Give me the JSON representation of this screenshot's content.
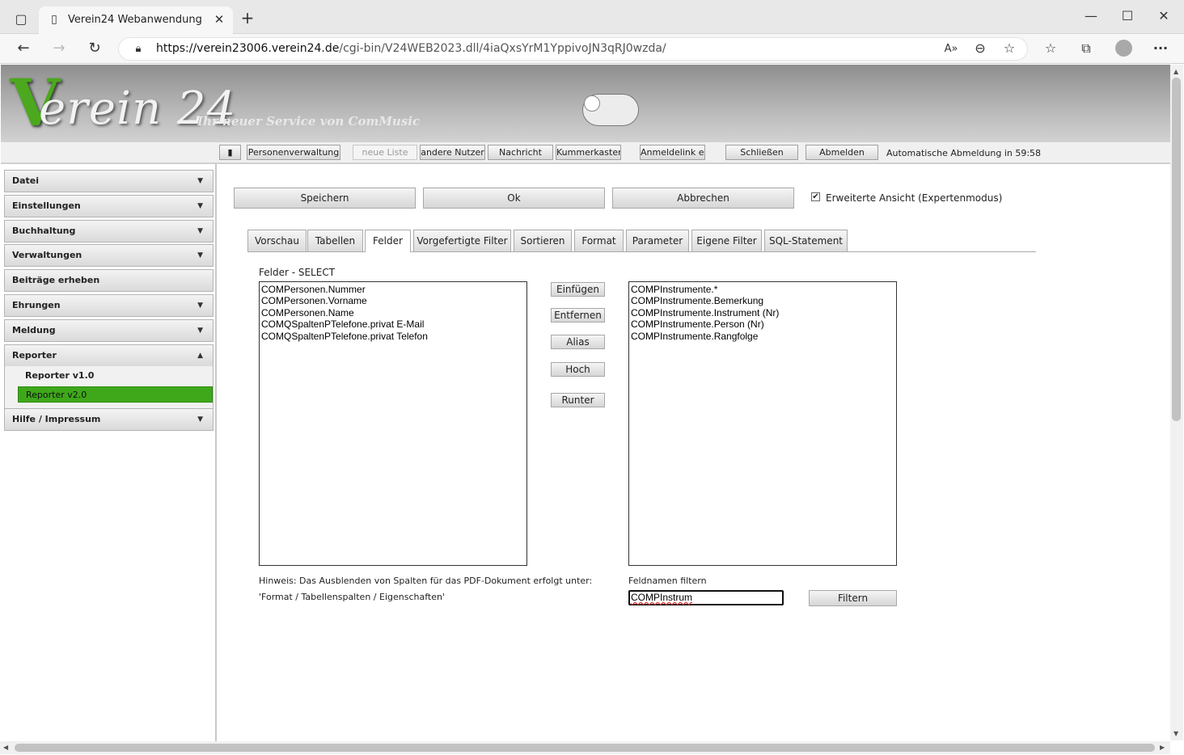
{
  "browser": {
    "tab_title": "Verein24 Webanwendung",
    "url_host": "https://verein23006.verein24.de",
    "url_path": "/cgi-bin/V24WEB2023.dll/4iaQxsYrM1YppivoJN3qRJ0wzda/"
  },
  "header": {
    "logo_v": "V",
    "logo_text": "erein 24",
    "slogan": "Ihr neuer Service von ComMusic"
  },
  "toolbar": {
    "menu_toggle": "▮",
    "buttons": [
      "Personenverwaltung",
      "neue Liste",
      "andere Nutzer",
      "Nachricht",
      "Kummerkasten",
      "Anmeldelink erst",
      "Schließen",
      "Abmelden"
    ],
    "auto_logout": "Automatische Abmeldung in 59:58"
  },
  "sidebar": {
    "items": [
      "Datei",
      "Einstellungen",
      "Buchhaltung",
      "Verwaltungen",
      "Beiträge erheben",
      "Ehrungen",
      "Meldung",
      "Reporter",
      "Hilfe / Impressum"
    ],
    "reporter_sub": [
      "Reporter v1.0",
      "Reporter v2.0"
    ]
  },
  "actions": {
    "save": "Speichern",
    "ok": "Ok",
    "cancel": "Abbrechen",
    "expert_mode": "Erweiterte Ansicht (Expertenmodus)",
    "expert_checked": true
  },
  "tabs": [
    "Vorschau",
    "Tabellen",
    "Felder",
    "Vorgefertigte Filter",
    "Sortieren",
    "Format",
    "Parameter",
    "Eigene Filter",
    "SQL-Statement"
  ],
  "active_tab": "Felder",
  "fields": {
    "select_label": "Felder - SELECT",
    "selected": [
      "COMPersonen.Nummer",
      "COMPersonen.Vorname",
      "COMPersonen.Name",
      "COMQSpaltenPTelefone.privat E-Mail",
      "COMQSpaltenPTelefone.privat Telefon"
    ],
    "available": [
      "COMPInstrumente.*",
      "COMPInstrumente.Bemerkung",
      "COMPInstrumente.Instrument (Nr)",
      "COMPInstrumente.Person (Nr)",
      "COMPInstrumente.Rangfolge"
    ],
    "buttons": [
      "Einfügen",
      "Entfernen",
      "Alias",
      "Hoch",
      "Runter"
    ],
    "hint_line1": "Hinweis: Das Ausblenden von Spalten für das PDF-Dokument erfolgt unter:",
    "hint_line2": "'Format / Tabellenspalten / Eigenschaften'",
    "filter_label": "Feldnamen filtern",
    "filter_value": "COMPInstrum",
    "filter_button": "Filtern"
  }
}
